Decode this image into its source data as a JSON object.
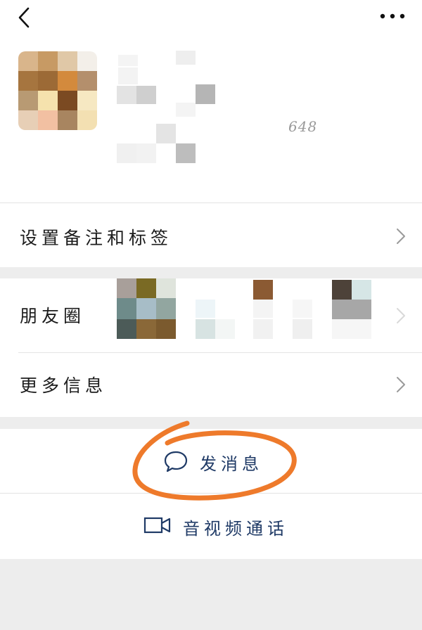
{
  "nav": {
    "back_icon": "chevron-left-icon",
    "more_icon": "more-dots-icon"
  },
  "profile": {
    "id_suffix": "648"
  },
  "rows": {
    "set_remark": "设置备注和标签",
    "moments": "朋友圈",
    "more_info": "更多信息"
  },
  "actions": {
    "send_message": "发消息",
    "video_call": "音视频通话",
    "send_message_icon": "chat-bubble-icon",
    "video_call_icon": "video-camera-icon"
  },
  "colors": {
    "accent_text": "#1f3a66",
    "annotation": "#ee7a2b",
    "background": "#ededed"
  }
}
